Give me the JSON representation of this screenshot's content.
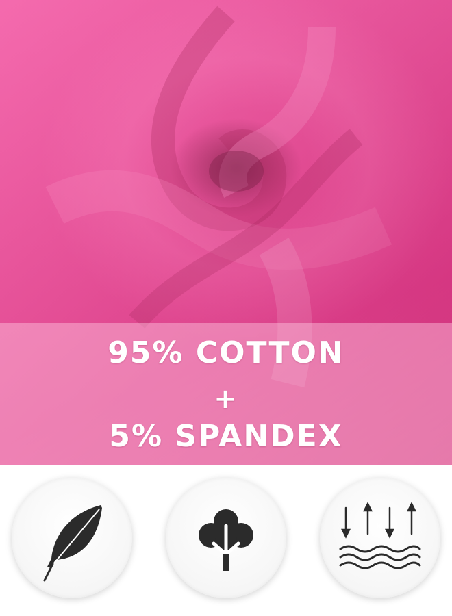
{
  "product_label": {
    "line1": "95% COTTON",
    "line2": "+",
    "line3": "5% SPANDEX"
  },
  "colors": {
    "fabric": "#ec3d91",
    "band": "#f7a8c8",
    "text": "#ffffff",
    "icon": "#2b2b2b"
  },
  "badges": [
    {
      "icon": "feather-icon"
    },
    {
      "icon": "cotton-flower-icon"
    },
    {
      "icon": "breathable-arrows-waves-icon"
    }
  ]
}
